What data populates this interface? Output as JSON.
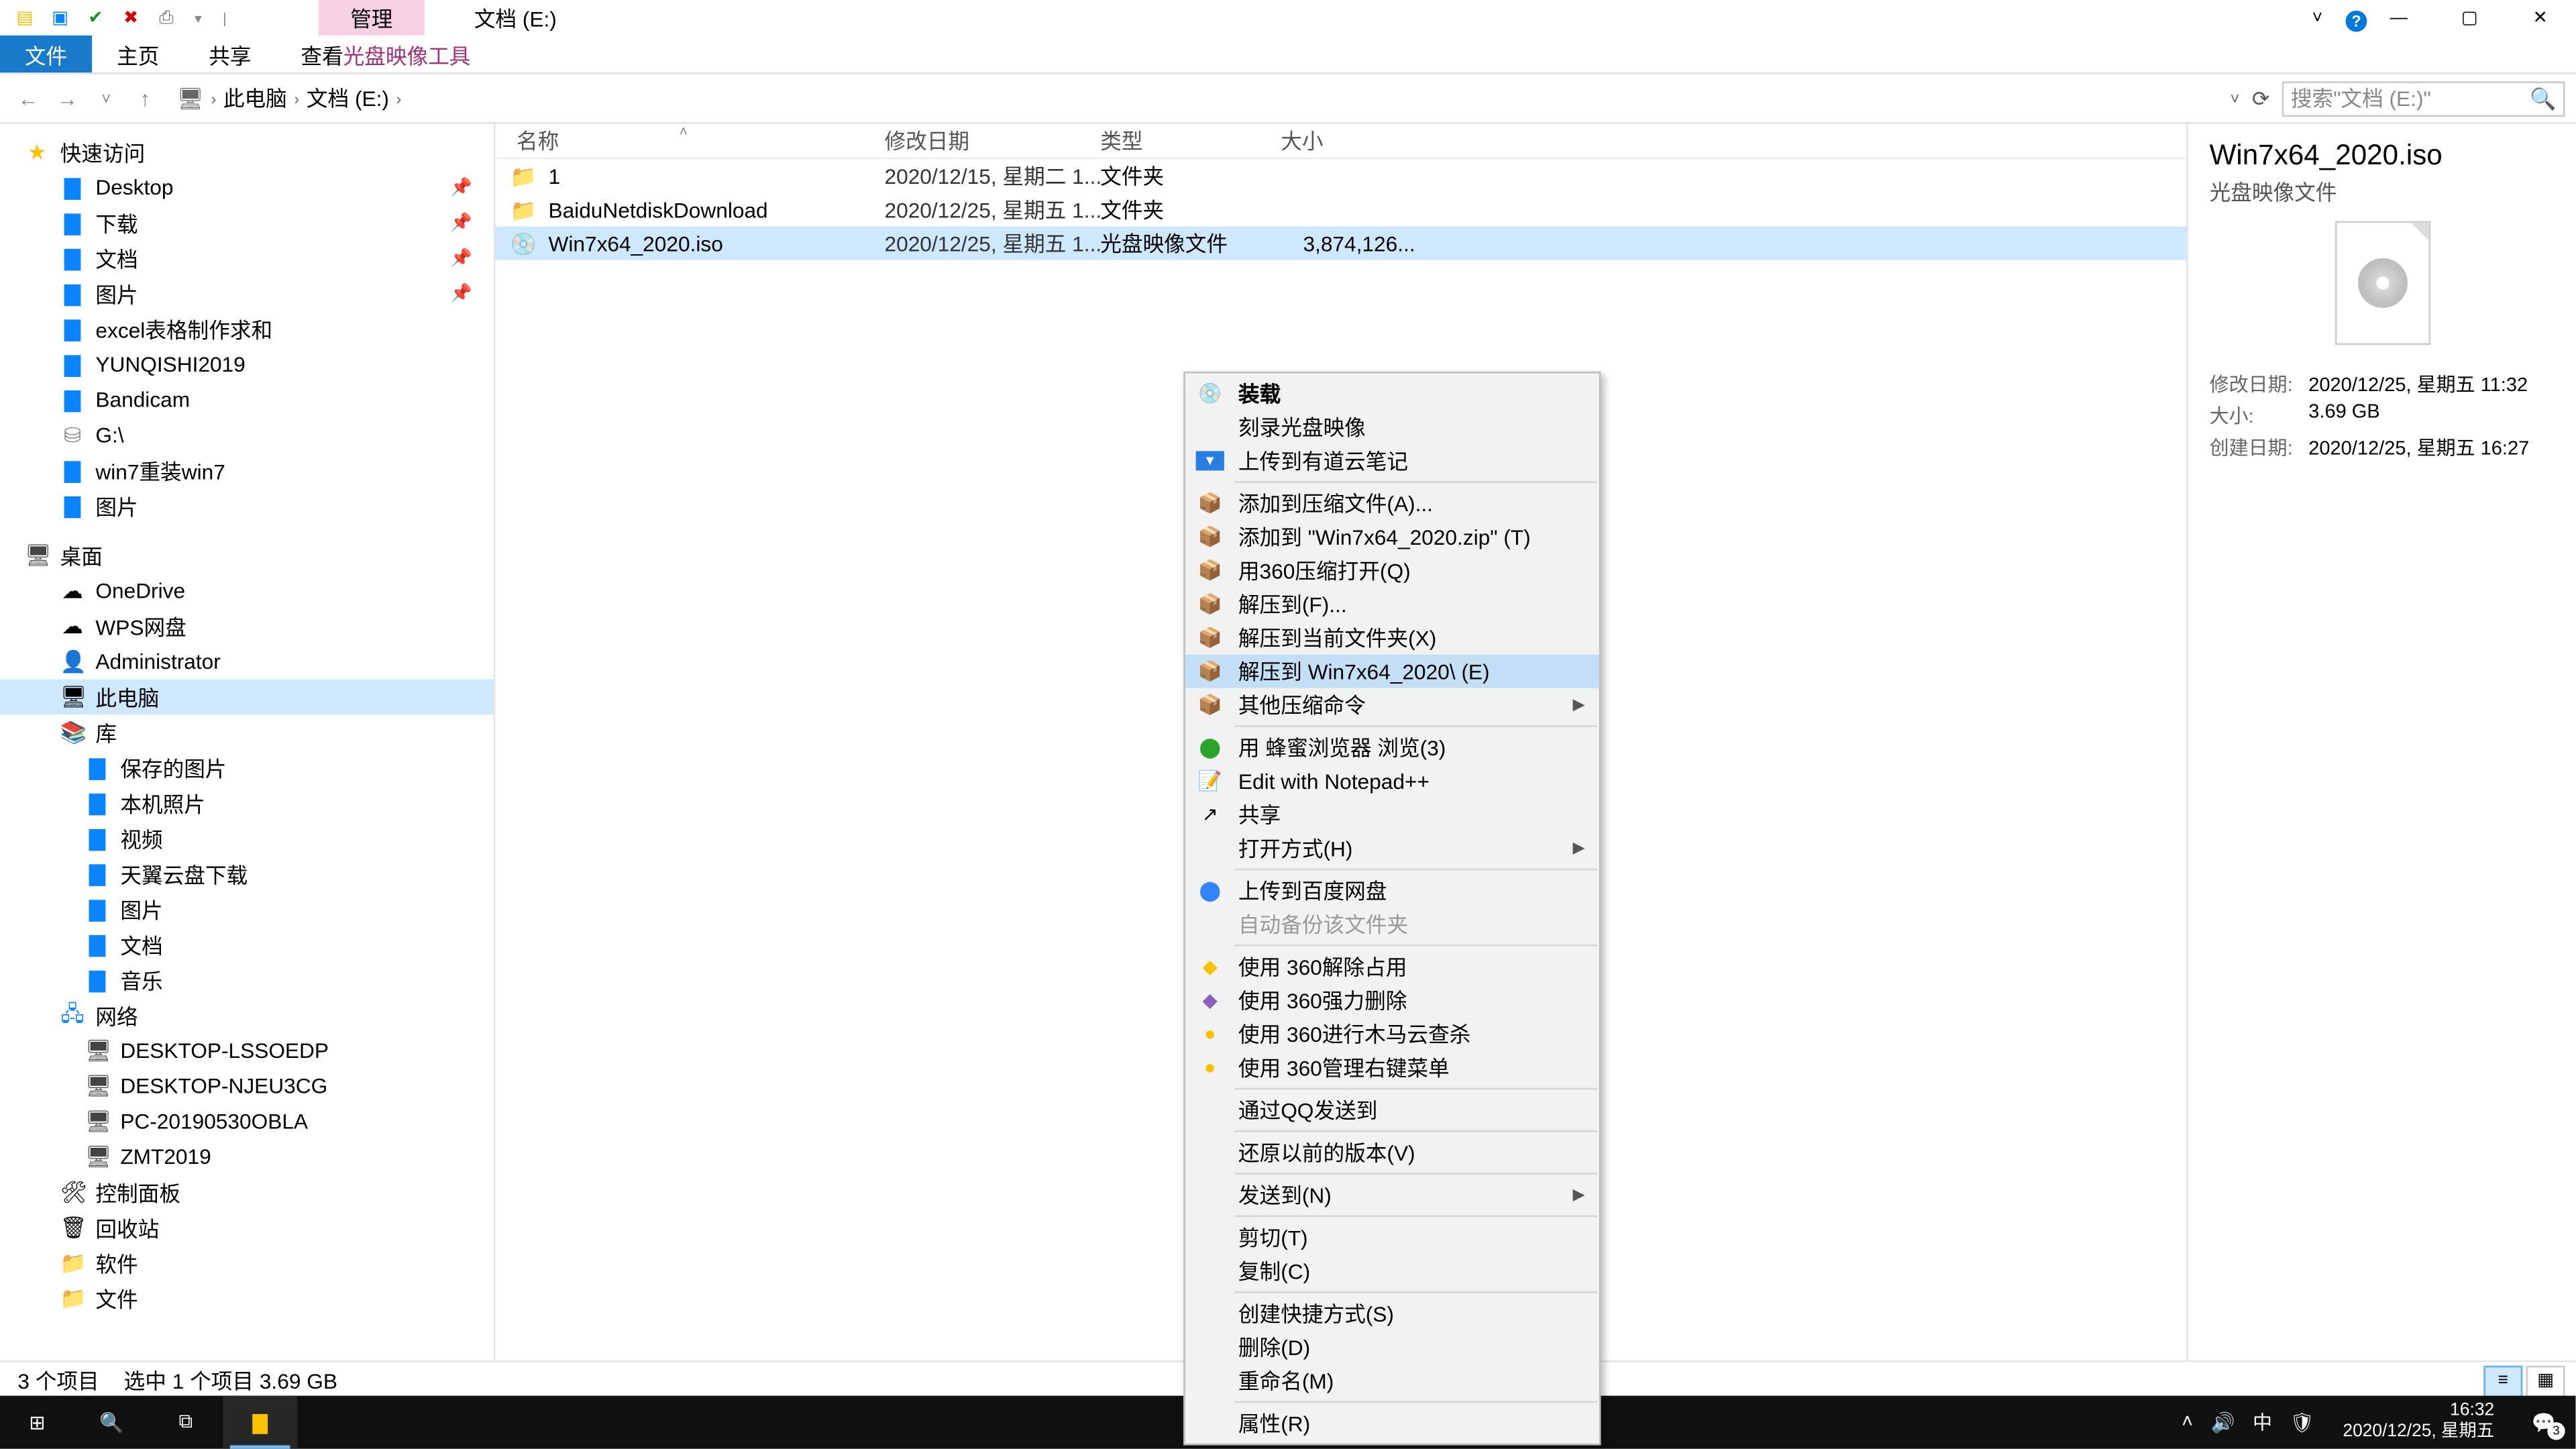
{
  "title": {
    "mgr_tab": "管理",
    "path_tab": "文档 (E:)"
  },
  "window_controls": {
    "min": "—",
    "max": "▢",
    "close": "✕",
    "help": "?"
  },
  "ribbon": {
    "file": "文件",
    "home": "主页",
    "share": "共享",
    "view": "查看",
    "iso_tool": "光盘映像工具"
  },
  "nav": {
    "this_pc": "此电脑",
    "drive": "文档 (E:)",
    "search_placeholder": "搜索\"文档 (E:)\""
  },
  "columns": {
    "name": "名称",
    "date": "修改日期",
    "type": "类型",
    "size": "大小"
  },
  "files": [
    {
      "icon": "📁",
      "name": "1",
      "date": "2020/12/15, 星期二 1...",
      "type": "文件夹",
      "size": ""
    },
    {
      "icon": "📁",
      "name": "BaiduNetdiskDownload",
      "date": "2020/12/25, 星期五 1...",
      "type": "文件夹",
      "size": ""
    },
    {
      "icon": "💿",
      "name": "Win7x64_2020.iso",
      "date": "2020/12/25, 星期五 1...",
      "type": "光盘映像文件",
      "size": "3,874,126..."
    }
  ],
  "sidebar": {
    "quick": {
      "label": "快速访问",
      "items": [
        {
          "t": "Desktop"
        },
        {
          "t": "下载"
        },
        {
          "t": "文档"
        },
        {
          "t": "图片"
        },
        {
          "t": "excel表格制作求和"
        },
        {
          "t": "YUNQISHI2019"
        },
        {
          "t": "Bandicam"
        },
        {
          "t": "G:\\",
          "disk": true
        },
        {
          "t": "win7重装win7"
        },
        {
          "t": "图片"
        }
      ]
    },
    "desktop": {
      "label": "桌面",
      "items": [
        {
          "t": "OneDrive",
          "ic": "☁"
        },
        {
          "t": "WPS网盘",
          "ic": "☁"
        },
        {
          "t": "Administrator",
          "ic": "👤"
        },
        {
          "t": "此电脑",
          "ic": "🖥",
          "sel": true
        },
        {
          "t": "库",
          "ic": "📚"
        }
      ]
    },
    "libs": [
      "保存的图片",
      "本机照片",
      "视频",
      "天翼云盘下载",
      "图片",
      "文档",
      "音乐"
    ],
    "network": {
      "label": "网络",
      "items": [
        "DESKTOP-LSSOEDP",
        "DESKTOP-NJEU3CG",
        "PC-20190530OBLA",
        "ZMT2019"
      ]
    },
    "misc": [
      {
        "t": "控制面板",
        "ic": "🛠"
      },
      {
        "t": "回收站",
        "ic": "🗑"
      },
      {
        "t": "软件",
        "ic": "📁"
      },
      {
        "t": "文件",
        "ic": "📁"
      }
    ]
  },
  "ctx": {
    "mount": "装载",
    "burn": "刻录光盘映像",
    "youdao": "上传到有道云笔记",
    "addarchive": "添加到压缩文件(A)...",
    "addzip": "添加到 \"Win7x64_2020.zip\" (T)",
    "open360": "用360压缩打开(Q)",
    "extractto": "解压到(F)...",
    "extracthere": "解压到当前文件夹(X)",
    "extractfolder": "解压到 Win7x64_2020\\ (E)",
    "othercompress": "其他压缩命令",
    "beebrowser": "用 蜂蜜浏览器 浏览(3)",
    "notepad": "Edit with Notepad++",
    "share": "共享",
    "openwith": "打开方式(H)",
    "baidu": "上传到百度网盘",
    "autobak": "自动备份该文件夹",
    "unlock360": "使用 360解除占用",
    "del360": "使用 360强力删除",
    "trojan360": "使用 360进行木马云查杀",
    "menu360": "使用 360管理右键菜单",
    "qqsend": "通过QQ发送到",
    "restore": "还原以前的版本(V)",
    "sendto": "发送到(N)",
    "cut": "剪切(T)",
    "copy": "复制(C)",
    "shortcut": "创建快捷方式(S)",
    "delete": "删除(D)",
    "rename": "重命名(M)",
    "props": "属性(R)"
  },
  "preview": {
    "title": "Win7x64_2020.iso",
    "subtitle": "光盘映像文件",
    "mod_k": "修改日期:",
    "mod_v": "2020/12/25, 星期五 11:32",
    "size_k": "大小:",
    "size_v": "3.69 GB",
    "create_k": "创建日期:",
    "create_v": "2020/12/25, 星期五 16:27"
  },
  "status": {
    "count": "3 个项目",
    "sel": "选中 1 个项目  3.69 GB"
  },
  "taskbar": {
    "time": "16:32",
    "date": "2020/12/25, 星期五",
    "ime": "中",
    "notif_badge": "3"
  }
}
